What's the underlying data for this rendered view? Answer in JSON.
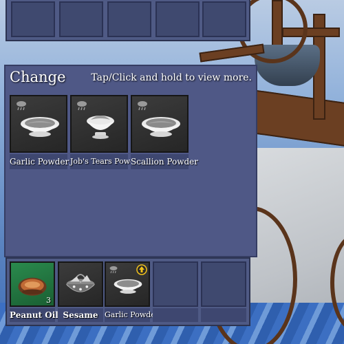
{
  "change_panel": {
    "title": "Change",
    "hint": "Tap/Click and hold to view more.",
    "items": [
      {
        "label": "Garlic Powder",
        "icon": "garlic-powder-bowl-icon"
      },
      {
        "label": "Job's Tears Powder",
        "icon": "jobs-tears-powder-bowl-icon"
      },
      {
        "label": "Scallion Powder",
        "icon": "scallion-powder-bowl-icon"
      }
    ]
  },
  "inventory": {
    "slots": [
      {
        "label": "Peanut Oil",
        "quantity": "3",
        "icon": "peanut-oil-icon"
      },
      {
        "label": "Sesame",
        "icon": "sesame-basket-icon"
      },
      {
        "label": "Garlic Powder",
        "icon": "garlic-powder-bowl-icon",
        "badge": "upgrade-arrow-icon"
      }
    ]
  },
  "colors": {
    "panel": "#4f5886",
    "slot_empty": "#3f496f",
    "item_bg": "#2e2e2e",
    "peanut_oil_bg": "#1f6b3c",
    "upgrade_badge": "#f2c21b"
  }
}
